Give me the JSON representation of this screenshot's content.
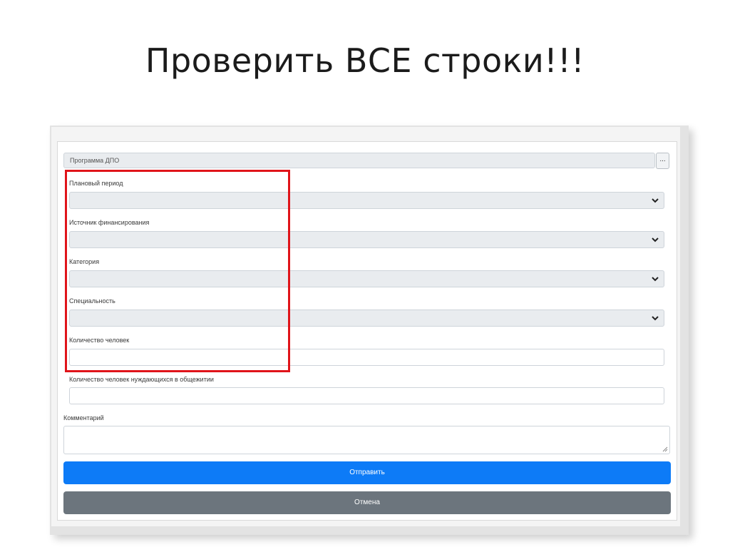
{
  "slide": {
    "title": "Проверить ВСЕ строки!!!"
  },
  "form": {
    "program": {
      "placeholder": "Программа ДПО",
      "browse_label": "..."
    },
    "fields": {
      "plan_period": {
        "label": "Плановый период",
        "value": ""
      },
      "funding_source": {
        "label": "Источник финансирования",
        "value": ""
      },
      "category": {
        "label": "Категория",
        "value": ""
      },
      "specialty": {
        "label": "Специальность",
        "value": ""
      },
      "people_count": {
        "label": "Количество человек",
        "value": ""
      },
      "dorm_count": {
        "label": "Количество человек нуждающихся в общежитии",
        "value": ""
      },
      "comment": {
        "label": "Комментарий",
        "value": ""
      }
    },
    "buttons": {
      "submit": "Отправить",
      "cancel": "Отмена"
    }
  },
  "colors": {
    "highlight": "#e0141a",
    "primary": "#0d7bf7",
    "secondary": "#6c757d"
  },
  "icons": {
    "select_arrow": "chevron-down-icon",
    "textarea_resize": "resize-grip-icon"
  }
}
